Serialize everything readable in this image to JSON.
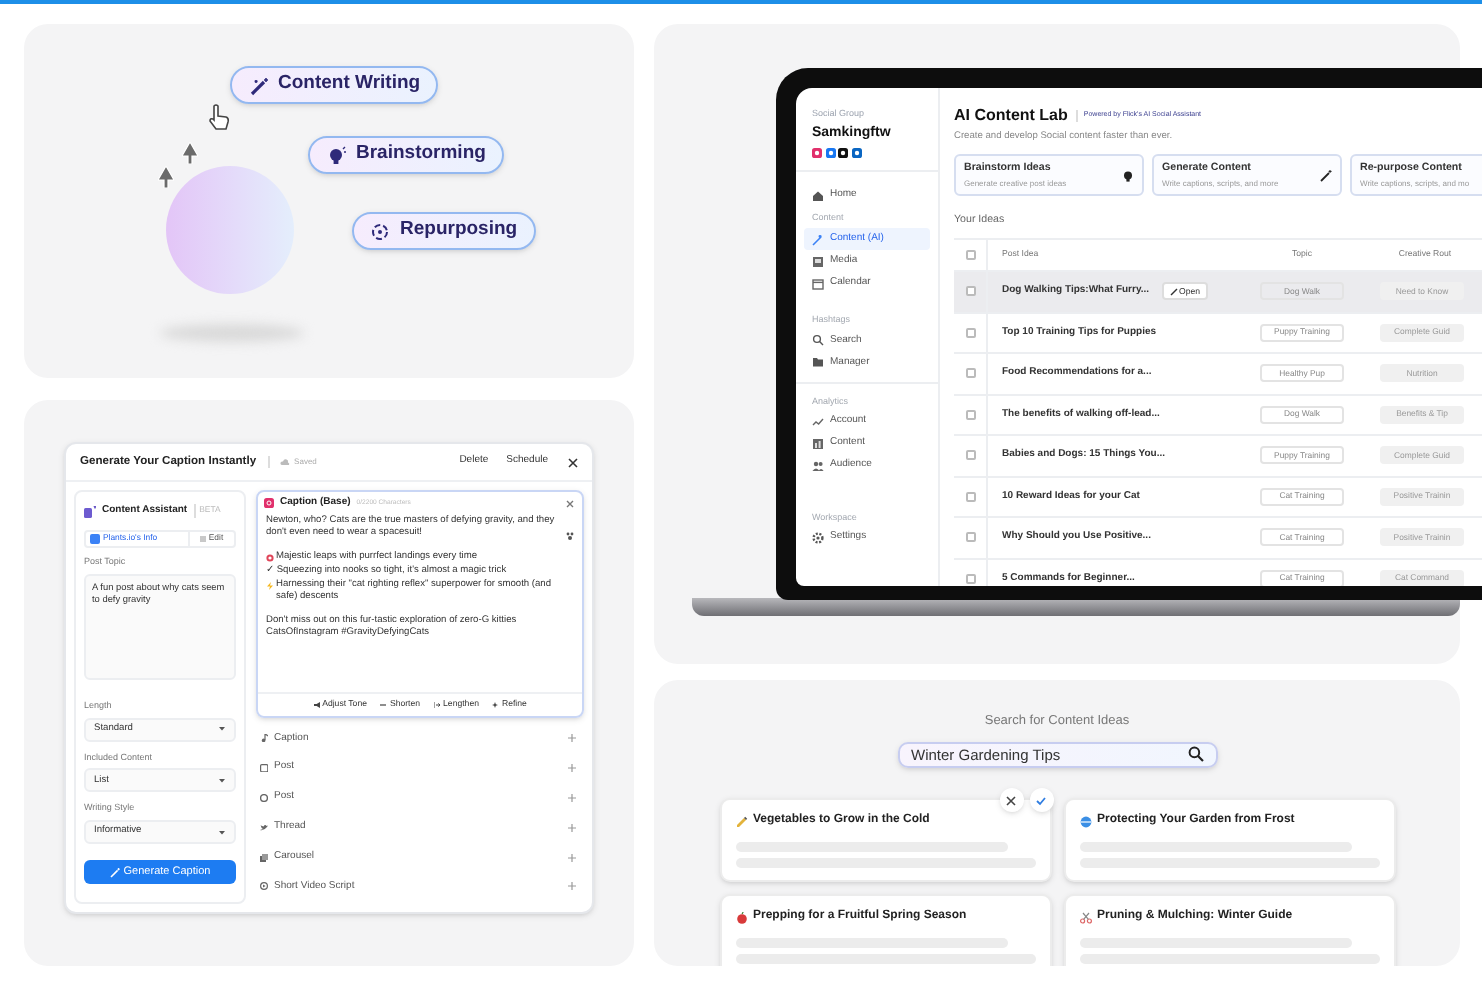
{
  "hero": {
    "pills": [
      {
        "label": "Content Writing"
      },
      {
        "label": "Brainstorming"
      },
      {
        "label": "Repurposing"
      }
    ]
  },
  "app": {
    "sidebar": {
      "group_label": "Social Group",
      "account": "Samkingftw",
      "sections": [
        {
          "items": [
            {
              "label": "Home",
              "selected": false
            }
          ]
        },
        {
          "heading": "Content",
          "items": [
            {
              "label": "Content (AI)",
              "selected": true
            },
            {
              "label": "Media",
              "selected": false
            },
            {
              "label": "Calendar",
              "selected": false
            }
          ]
        },
        {
          "heading": "Hashtags",
          "items": [
            {
              "label": "Search",
              "selected": false
            },
            {
              "label": "Manager",
              "selected": false
            }
          ]
        },
        {
          "heading": "Analytics",
          "items": [
            {
              "label": "Account",
              "selected": false
            },
            {
              "label": "Content",
              "selected": false
            },
            {
              "label": "Audience",
              "selected": false
            }
          ]
        },
        {
          "heading": "Workspace",
          "items": [
            {
              "label": "Settings",
              "selected": false
            }
          ]
        }
      ]
    },
    "title": "AI Content Lab",
    "powered_by": "Powered by Flick's AI Social Assistant",
    "subtitle": "Create and develop Social content faster than ever.",
    "actions": [
      {
        "title": "Brainstorm Ideas",
        "description": "Generate creative post ideas"
      },
      {
        "title": "Generate Content",
        "description": "Write captions, scripts, and more"
      },
      {
        "title": "Re-purpose Content",
        "description": "Write captions, scripts, and mo"
      }
    ],
    "ideas_heading": "Your Ideas",
    "table": {
      "columns": [
        "Post Idea",
        "Topic",
        "Creative Rout"
      ],
      "all_checked": false,
      "rows": [
        {
          "idea": "Dog Walking Tips:What Furry...",
          "topic": "Dog Walk",
          "route": "Need to Know",
          "checked": false,
          "selected": true,
          "action": "Open"
        },
        {
          "idea": "Top 10 Training Tips for Puppies",
          "topic": "Puppy Training",
          "route": "Complete Guid",
          "checked": false,
          "selected": false
        },
        {
          "idea": "Food Recommendations for a...",
          "topic": "Healthy Pup",
          "route": "Nutrition",
          "checked": false,
          "selected": false
        },
        {
          "idea": "The benefits of walking off-lead...",
          "topic": "Dog Walk",
          "route": "Benefits & Tip",
          "checked": false,
          "selected": false
        },
        {
          "idea": "Babies and Dogs: 15 Things You...",
          "topic": "Puppy Training",
          "route": "Complete Guid",
          "checked": false,
          "selected": false
        },
        {
          "idea": "10 Reward Ideas for your Cat",
          "topic": "Cat Training",
          "route": "Positive Trainin",
          "checked": false,
          "selected": false
        },
        {
          "idea": "Why Should you Use Positive...",
          "topic": "Cat Training",
          "route": "Positive Trainin",
          "checked": false,
          "selected": false
        },
        {
          "idea": "5 Commands for Beginner...",
          "topic": "Cat Training",
          "route": "Cat Command",
          "checked": false,
          "selected": false
        }
      ]
    }
  },
  "caption_tool": {
    "title": "Generate Your Caption Instantly",
    "save_status": "Saved",
    "actions": [
      "Delete",
      "Schedule"
    ],
    "assistant": {
      "title": "Content Assistant",
      "badge": "BETA",
      "info": {
        "label": "Plants.io's Info",
        "checked": true
      },
      "edit": "Edit",
      "topic": {
        "label": "Post Topic",
        "value": "A fun post about why cats seem to defy gravity"
      },
      "selects": [
        {
          "label": "Length",
          "value": "Standard"
        },
        {
          "label": "Included Content",
          "value": "List"
        },
        {
          "label": "Writing Style",
          "value": "Informative"
        }
      ],
      "button": "Generate Caption"
    },
    "editor": {
      "title": "Caption (Base)",
      "counter": "0/2200 Characters",
      "paragraphs": [
        [
          {
            "kind": "trailing-icon",
            "text": "Newton, who? Cats are the true masters of defying gravity, and they don't even need to wear a spacesuit!"
          }
        ],
        [
          {
            "kind": "leading-icon",
            "text": "Majestic leaps with purrfect landings every time"
          },
          {
            "kind": "plain",
            "text": "✓ Squeezing into nooks so tight, it's almost a magic trick"
          },
          {
            "kind": "leading-icon",
            "text": "Harnessing their \"cat righting reflex\" superpower for smooth (and safe) descents"
          }
        ],
        [
          {
            "kind": "plain",
            "text": "Don't miss out on this fur-tastic exploration of zero-G kitties CatsOfInstagram #GravityDefyingCats"
          }
        ]
      ],
      "tools": [
        "Adjust Tone",
        "Shorten",
        "Lengthen",
        "Refine"
      ]
    },
    "formats": [
      "Caption",
      "Post",
      "Post",
      "Thread",
      "Carousel",
      "Short Video Script"
    ]
  },
  "idea_search": {
    "heading": "Search for Content Ideas",
    "query": "Winter Gardening Tips",
    "results": [
      "Vegetables to Grow in the Cold",
      "Protecting Your Garden from Frost",
      "Prepping for a Fruitful Spring Season",
      "Pruning & Mulching: Winter Guide"
    ]
  }
}
